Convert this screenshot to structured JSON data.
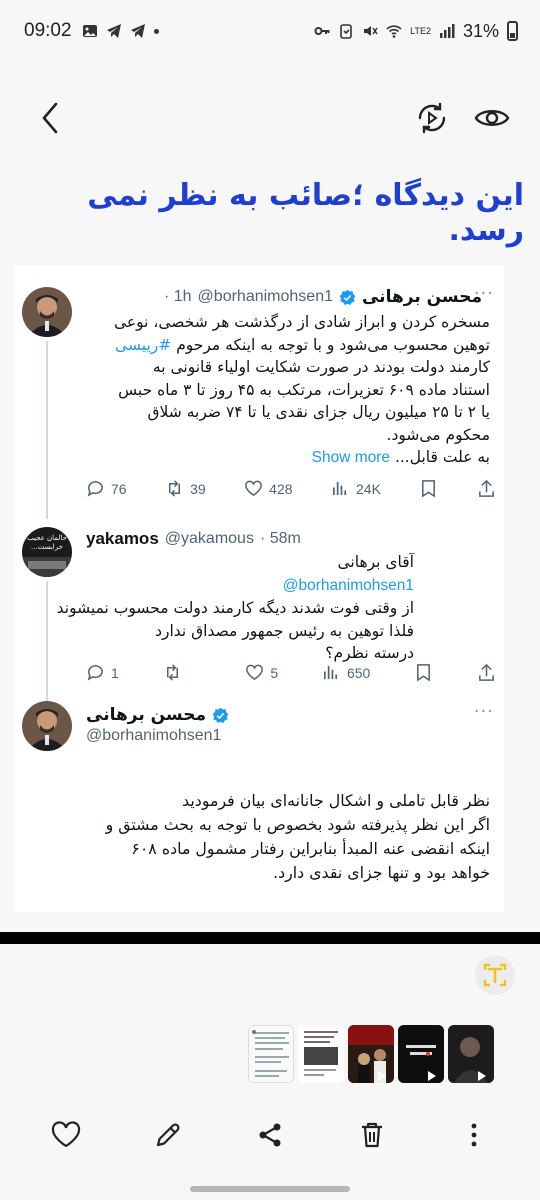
{
  "status_bar": {
    "time": "09:02",
    "battery": "31%",
    "network": "LTE2"
  },
  "headline": "این دیدگاه ؛صائب به نظر نمی رسد.",
  "tweets": [
    {
      "name": "محسن برهانی",
      "handle": "@borhanimohsen1",
      "time": "· 1h",
      "lines": [
        "مسخره کردن و ابراز شادی از درگذشت هر شخصی، نوعی",
        "توهین محسوب می‌شود و با توجه به اینکه مرحوم",
        "کارمند دولت بودند در صورت شکایت اولیاء قانونی به",
        "استناد ماده ۶۰۹ تعزیرات، مرتکب به ۴۵ روز تا ۳ ماه حبس",
        "یا ۲ تا ۲۵ میلیون ریال جزای نقدی یا تا ۷۴ ضربه شلاق",
        "محکوم می‌شود.",
        "به علت قابل..."
      ],
      "hashtag": "#رییسی",
      "show_more": "Show more",
      "stats": {
        "replies": "76",
        "retweets": "39",
        "likes": "428",
        "views": "24K"
      }
    },
    {
      "name": "yakamos",
      "handle": "@yakamous",
      "time": "· 58m",
      "avatar_text": "حالمان عجیب خرابست...",
      "greeting": "آقای برهانی",
      "mention": "@borhanimohsen1",
      "lines": [
        "از وقتی فوت شدند دیگه کارمند دولت محسوب نمیشوند",
        "فلذا توهین به رئیس جمهور مصداق ندارد",
        "درسته نظرم؟"
      ],
      "stats": {
        "replies": "1",
        "retweets": "",
        "likes": "5",
        "views": "650"
      }
    },
    {
      "name": "محسن برهانی",
      "handle": "@borhanimohsen1",
      "lines": [
        "نظر قابل تاملی و اشکال جانانه‌ای بیان فرمودید",
        "اگر این نظر پذیرفته شود بخصوص با توجه به بحث مشتق و",
        "اینکه انقضی عنه المبدأ بنابراین رفتار مشمول ماده ۶۰۸",
        "خواهد بود و تنها جزای نقدی دارد."
      ]
    }
  ],
  "colors": {
    "headline": "#1f3fd0",
    "link": "#1d9bf0",
    "muted": "#536471",
    "accent_yellow": "#f2c318"
  },
  "icons": [
    "back-arrow-icon",
    "ocr-scan-icon",
    "eye-icon",
    "text-extract-icon",
    "heart-icon",
    "edit-icon",
    "share-icon",
    "delete-icon",
    "more-icon"
  ]
}
